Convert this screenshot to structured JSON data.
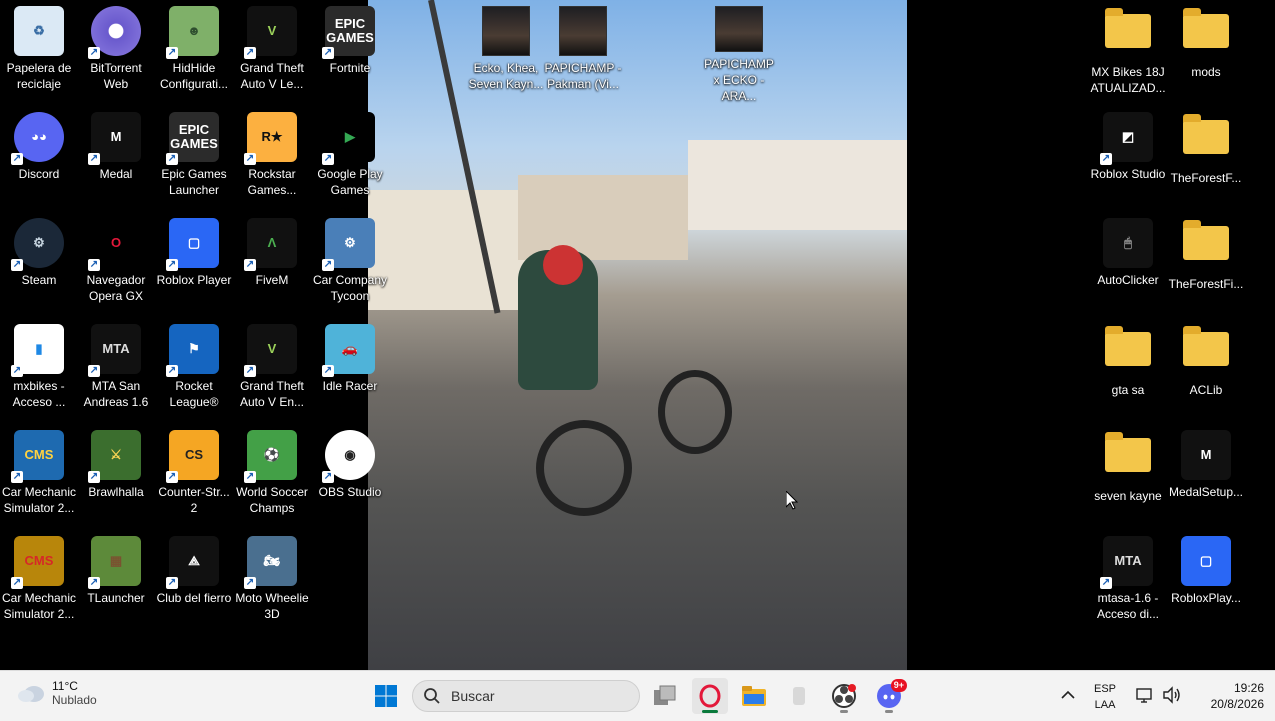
{
  "desktop": {
    "left_icons": [
      {
        "label": "Papelera de reciclaje",
        "icon": "recycle-bin-icon",
        "shortcut": false
      },
      {
        "label": "BitTorrent Web",
        "icon": "bittorrent-icon",
        "shortcut": true
      },
      {
        "label": "HidHide Configurati...",
        "icon": "hidhide-icon",
        "shortcut": true
      },
      {
        "label": "Grand Theft Auto V Le...",
        "icon": "gta-v-icon",
        "shortcut": true
      },
      {
        "label": "Fortnite",
        "icon": "epic-games-icon",
        "shortcut": true
      },
      {
        "label": "Discord",
        "icon": "discord-icon",
        "shortcut": true
      },
      {
        "label": "Medal",
        "icon": "medal-icon",
        "shortcut": true
      },
      {
        "label": "Epic Games Launcher",
        "icon": "epic-games-icon",
        "shortcut": true
      },
      {
        "label": "Rockstar Games...",
        "icon": "rockstar-icon",
        "shortcut": true
      },
      {
        "label": "Google Play Games",
        "icon": "google-play-games-icon",
        "shortcut": true
      },
      {
        "label": "Steam",
        "icon": "steam-icon",
        "shortcut": true
      },
      {
        "label": "Navegador Opera GX",
        "icon": "opera-gx-icon",
        "shortcut": true
      },
      {
        "label": "Roblox Player",
        "icon": "roblox-icon",
        "shortcut": true
      },
      {
        "label": "FiveM",
        "icon": "fivem-icon",
        "shortcut": true
      },
      {
        "label": "Car Company Tycoon",
        "icon": "car-company-tycoon-icon",
        "shortcut": true
      },
      {
        "label": "mxbikes - Acceso ...",
        "icon": "mxbikes-icon",
        "shortcut": true
      },
      {
        "label": "MTA San Andreas 1.6",
        "icon": "mta-icon",
        "shortcut": true
      },
      {
        "label": "Rocket League®",
        "icon": "rocket-league-icon",
        "shortcut": true
      },
      {
        "label": "Grand Theft Auto V En...",
        "icon": "gta-v-icon",
        "shortcut": true
      },
      {
        "label": "Idle Racer",
        "icon": "idle-racer-icon",
        "shortcut": true
      },
      {
        "label": "Car Mechanic Simulator 2...",
        "icon": "car-mechanic-icon",
        "shortcut": true
      },
      {
        "label": "Brawlhalla",
        "icon": "brawlhalla-icon",
        "shortcut": true
      },
      {
        "label": "Counter-Str... 2",
        "icon": "counter-strike-icon",
        "shortcut": true
      },
      {
        "label": "World Soccer Champs",
        "icon": "world-soccer-icon",
        "shortcut": true
      },
      {
        "label": "OBS Studio",
        "icon": "obs-icon",
        "shortcut": true
      },
      {
        "label": "Car Mechanic Simulator 2...",
        "icon": "cms-icon",
        "shortcut": true
      },
      {
        "label": "TLauncher",
        "icon": "tlauncher-icon",
        "shortcut": true
      },
      {
        "label": "Club del fierro",
        "icon": "club-del-fierro-icon",
        "shortcut": true
      },
      {
        "label": "Moto Wheelie 3D",
        "icon": "moto-wheelie-icon",
        "shortcut": true
      }
    ],
    "video_icons": [
      {
        "label": "Ecko, Khea, Seven Kayn...",
        "icon": "video-file-icon"
      },
      {
        "label": "PAPICHAMP - Pakman (Vi...",
        "icon": "video-file-icon"
      },
      {
        "label": "PAPICHAMP x ECKO - ARA...",
        "icon": "video-file-icon"
      }
    ],
    "right_icons": [
      {
        "label": "MX Bikes 18J ATUALIZAD...",
        "icon": "folder-icon",
        "shortcut": false
      },
      {
        "label": "mods",
        "icon": "folder-icon",
        "shortcut": false
      },
      {
        "label": "Roblox Studio",
        "icon": "roblox-studio-icon",
        "shortcut": true
      },
      {
        "label": "TheForestF...",
        "icon": "folder-icon",
        "shortcut": false
      },
      {
        "label": "AutoClicker",
        "icon": "mouse-icon",
        "shortcut": false
      },
      {
        "label": "TheForestFi...",
        "icon": "folder-icon",
        "shortcut": false
      },
      {
        "label": "gta sa",
        "icon": "folder-icon",
        "shortcut": false
      },
      {
        "label": "ACLib",
        "icon": "folder-icon",
        "shortcut": false
      },
      {
        "label": "seven kayne",
        "icon": "folder-icon",
        "shortcut": false
      },
      {
        "label": "MedalSetup...",
        "icon": "medal-icon",
        "shortcut": false
      },
      {
        "label": "mtasa-1.6 - Acceso di...",
        "icon": "mta-icon",
        "shortcut": true
      },
      {
        "label": "RobloxPlay...",
        "icon": "roblox-icon",
        "shortcut": false
      }
    ]
  },
  "taskbar": {
    "weather": {
      "temp": "11°C",
      "condition": "Nublado",
      "icon": "cloud-icon"
    },
    "start_icon": "windows-start-icon",
    "search_placeholder": "Buscar",
    "apps": [
      {
        "name": "task-view-icon"
      },
      {
        "name": "opera-gx-icon"
      },
      {
        "name": "file-explorer-icon"
      },
      {
        "name": "app-icon"
      },
      {
        "name": "obs-icon"
      },
      {
        "name": "discord-icon",
        "badge": "9+"
      }
    ],
    "tray": {
      "language": "ESP",
      "layout": "LAA",
      "time": "19:26",
      "date": "20/8/2026"
    }
  }
}
